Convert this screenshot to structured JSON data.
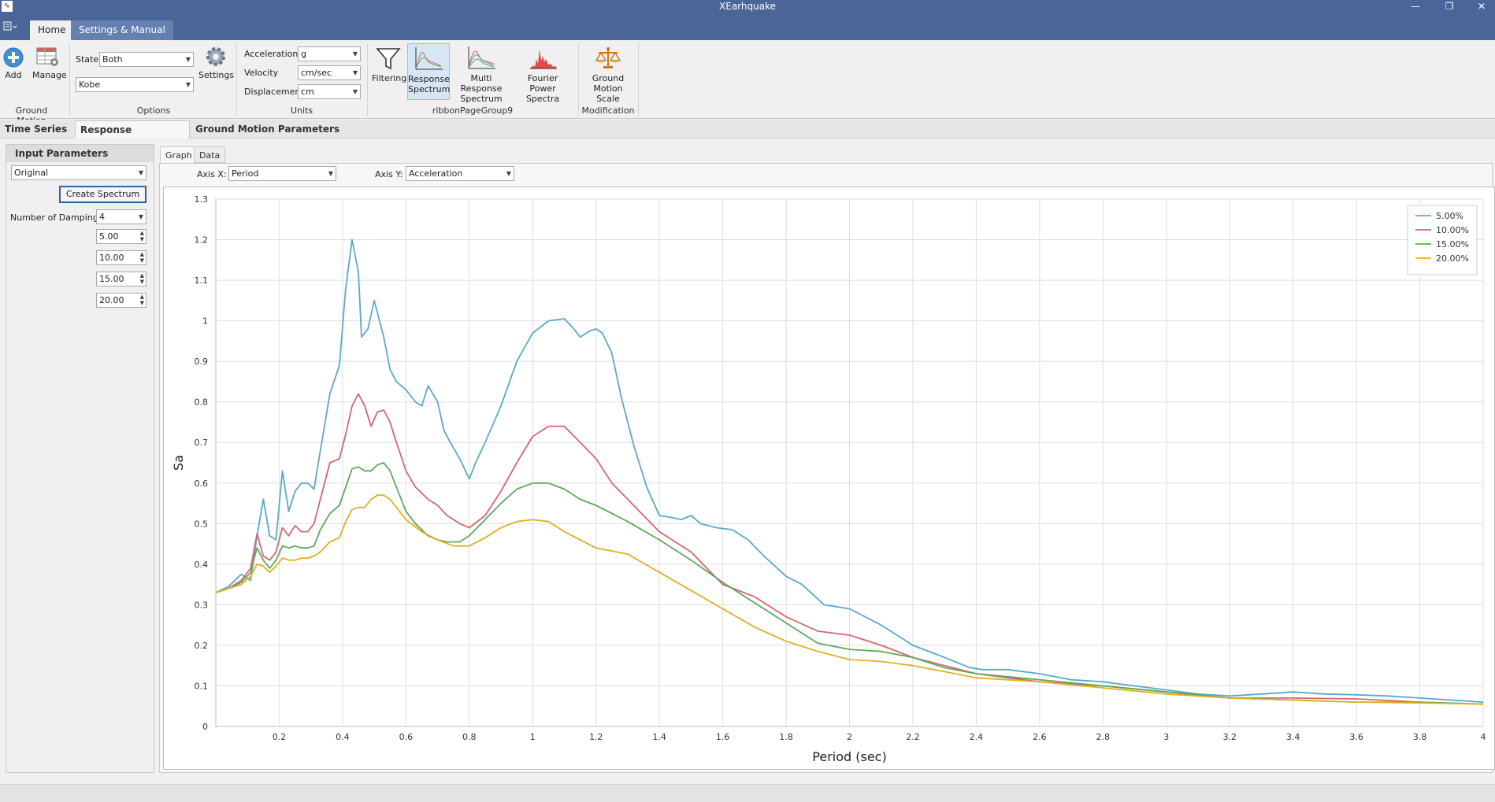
{
  "window": {
    "title": "XEarhquake",
    "app_icon": "seismograph-icon",
    "min_glyph": "—",
    "restore_glyph": "❐",
    "close_glyph": "✕"
  },
  "ribbon_tabs": [
    {
      "label": "Home",
      "active": true
    },
    {
      "label": "Settings & Manual",
      "active": false
    }
  ],
  "ribbon": {
    "ground_motion": {
      "add_label": "Add",
      "manage_label": "Manage",
      "group_label": "Ground Motion"
    },
    "options": {
      "state_label": "State",
      "state_value": "Both",
      "record_value": "Kobe",
      "settings_label": "Settings",
      "group_label": "Options"
    },
    "units": {
      "acceleration_label": "Acceleration",
      "acceleration_value": "g",
      "velocity_label": "Velocity",
      "velocity_value": "cm/sec",
      "displacement_label": "Displacement",
      "displacement_value": "cm",
      "group_label": "Units"
    },
    "page_group9": {
      "filtering_label": "Filtering",
      "response_spectrum_label": [
        "Response",
        "Spectrum"
      ],
      "multi_response_label": [
        "Multi Response",
        "Spectrum"
      ],
      "fourier_label": [
        "Fourier",
        "Power Spectra"
      ],
      "group_label": "ribbonPageGroup9"
    },
    "modification": {
      "ground_motion_scale_label": [
        "Ground",
        "Motion Scale"
      ],
      "group_label": "Modification"
    }
  },
  "doc_tabs": [
    {
      "label": "Time Series",
      "active": false
    },
    {
      "label": "Response Spectrum",
      "active": true,
      "close": "✕"
    },
    {
      "label": "Ground Motion Parameters",
      "active": false
    }
  ],
  "input_panel": {
    "title": "Input Parameters",
    "source_value": "Original",
    "create_button": "Create Spectrum",
    "dampings_label": "Number of Dampings:",
    "dampings_value": "4",
    "damping_values": [
      "5.00",
      "10.00",
      "15.00",
      "20.00"
    ]
  },
  "view_tabs": [
    {
      "label": "Graph",
      "active": true
    },
    {
      "label": "Data",
      "active": false
    }
  ],
  "axis_select": {
    "x_label": "Axis X:",
    "x_value": "Period",
    "y_label": "Axis Y:",
    "y_value": "Acceleration"
  },
  "chart_data": {
    "type": "line",
    "title": "",
    "xlabel": "Period (sec)",
    "ylabel": "Sa",
    "xlim": [
      0,
      4
    ],
    "ylim": [
      0,
      1.3
    ],
    "xticks": [
      "0.2",
      "0.4",
      "0.6",
      "0.8",
      "1",
      "1.2",
      "1.4",
      "1.6",
      "1.8",
      "2",
      "2.2",
      "2.4",
      "2.6",
      "2.8",
      "3",
      "3.2",
      "3.4",
      "3.6",
      "3.8",
      "4"
    ],
    "yticks": [
      "0",
      "0.1",
      "0.2",
      "0.3",
      "0.4",
      "0.5",
      "0.6",
      "0.7",
      "0.8",
      "0.9",
      "1",
      "1.1",
      "1.2",
      "1.3"
    ],
    "grid": true,
    "legend_position": "top-right",
    "series": [
      {
        "name": "5.00%",
        "color": "#5aa9c8",
        "x": [
          0,
          0.04,
          0.08,
          0.11,
          0.13,
          0.15,
          0.17,
          0.19,
          0.21,
          0.23,
          0.25,
          0.27,
          0.29,
          0.31,
          0.33,
          0.36,
          0.39,
          0.41,
          0.43,
          0.45,
          0.46,
          0.48,
          0.5,
          0.53,
          0.55,
          0.57,
          0.6,
          0.63,
          0.65,
          0.67,
          0.7,
          0.72,
          0.74,
          0.77,
          0.8,
          0.82,
          0.85,
          0.9,
          0.95,
          1.0,
          1.05,
          1.1,
          1.13,
          1.15,
          1.18,
          1.2,
          1.22,
          1.25,
          1.28,
          1.32,
          1.36,
          1.4,
          1.44,
          1.47,
          1.5,
          1.53,
          1.58,
          1.63,
          1.68,
          1.73,
          1.8,
          1.85,
          1.92,
          2.0,
          2.1,
          2.2,
          2.3,
          2.38,
          2.42,
          2.5,
          2.6,
          2.7,
          2.8,
          2.9,
          3.0,
          3.1,
          3.2,
          3.3,
          3.4,
          3.5,
          3.6,
          3.7,
          3.8,
          3.9,
          4.0
        ],
        "y": [
          0.33,
          0.345,
          0.375,
          0.36,
          0.47,
          0.56,
          0.47,
          0.46,
          0.63,
          0.53,
          0.58,
          0.6,
          0.6,
          0.585,
          0.68,
          0.82,
          0.89,
          1.08,
          1.2,
          1.12,
          0.96,
          0.98,
          1.05,
          0.96,
          0.88,
          0.85,
          0.83,
          0.8,
          0.79,
          0.84,
          0.8,
          0.73,
          0.7,
          0.66,
          0.61,
          0.65,
          0.7,
          0.79,
          0.9,
          0.97,
          1.0,
          1.005,
          0.98,
          0.96,
          0.975,
          0.98,
          0.97,
          0.92,
          0.81,
          0.69,
          0.59,
          0.52,
          0.515,
          0.51,
          0.52,
          0.5,
          0.49,
          0.485,
          0.46,
          0.42,
          0.37,
          0.35,
          0.3,
          0.29,
          0.25,
          0.2,
          0.17,
          0.145,
          0.14,
          0.14,
          0.13,
          0.115,
          0.11,
          0.1,
          0.09,
          0.08,
          0.075,
          0.08,
          0.085,
          0.08,
          0.078,
          0.075,
          0.07,
          0.065,
          0.06
        ]
      },
      {
        "name": "10.00%",
        "color": "#d56670",
        "x": [
          0,
          0.04,
          0.08,
          0.11,
          0.13,
          0.15,
          0.17,
          0.19,
          0.21,
          0.23,
          0.25,
          0.27,
          0.29,
          0.31,
          0.33,
          0.36,
          0.39,
          0.41,
          0.43,
          0.45,
          0.47,
          0.49,
          0.51,
          0.53,
          0.55,
          0.57,
          0.6,
          0.63,
          0.67,
          0.7,
          0.73,
          0.77,
          0.8,
          0.85,
          0.9,
          0.95,
          1.0,
          1.05,
          1.1,
          1.15,
          1.2,
          1.25,
          1.3,
          1.35,
          1.4,
          1.5,
          1.6,
          1.7,
          1.8,
          1.9,
          2.0,
          2.1,
          2.2,
          2.3,
          2.4,
          2.5,
          2.6,
          2.8,
          3.0,
          3.2,
          3.4,
          3.6,
          3.8,
          4.0
        ],
        "y": [
          0.33,
          0.34,
          0.36,
          0.39,
          0.475,
          0.42,
          0.41,
          0.43,
          0.49,
          0.47,
          0.495,
          0.48,
          0.48,
          0.5,
          0.56,
          0.65,
          0.66,
          0.72,
          0.79,
          0.82,
          0.79,
          0.74,
          0.775,
          0.78,
          0.75,
          0.7,
          0.63,
          0.59,
          0.56,
          0.545,
          0.52,
          0.5,
          0.49,
          0.52,
          0.58,
          0.65,
          0.715,
          0.74,
          0.74,
          0.7,
          0.66,
          0.6,
          0.56,
          0.52,
          0.48,
          0.43,
          0.35,
          0.32,
          0.27,
          0.235,
          0.225,
          0.2,
          0.17,
          0.15,
          0.13,
          0.12,
          0.11,
          0.1,
          0.085,
          0.07,
          0.07,
          0.068,
          0.06,
          0.055
        ]
      },
      {
        "name": "15.00%",
        "color": "#5fa85c",
        "x": [
          0,
          0.04,
          0.08,
          0.11,
          0.13,
          0.15,
          0.17,
          0.19,
          0.21,
          0.23,
          0.25,
          0.27,
          0.29,
          0.31,
          0.33,
          0.36,
          0.39,
          0.41,
          0.43,
          0.45,
          0.47,
          0.49,
          0.51,
          0.53,
          0.55,
          0.57,
          0.6,
          0.63,
          0.67,
          0.7,
          0.73,
          0.77,
          0.8,
          0.85,
          0.9,
          0.95,
          1.0,
          1.05,
          1.1,
          1.15,
          1.2,
          1.3,
          1.4,
          1.5,
          1.6,
          1.7,
          1.8,
          1.9,
          2.0,
          2.1,
          2.2,
          2.3,
          2.4,
          2.6,
          2.8,
          3.0,
          3.2,
          3.4,
          3.6,
          3.8,
          4.0
        ],
        "y": [
          0.33,
          0.34,
          0.355,
          0.38,
          0.44,
          0.41,
          0.39,
          0.41,
          0.445,
          0.44,
          0.445,
          0.44,
          0.44,
          0.445,
          0.485,
          0.525,
          0.545,
          0.59,
          0.635,
          0.64,
          0.63,
          0.63,
          0.645,
          0.65,
          0.63,
          0.59,
          0.53,
          0.5,
          0.47,
          0.46,
          0.455,
          0.455,
          0.47,
          0.51,
          0.55,
          0.585,
          0.6,
          0.6,
          0.585,
          0.56,
          0.545,
          0.505,
          0.46,
          0.41,
          0.355,
          0.305,
          0.255,
          0.205,
          0.19,
          0.185,
          0.17,
          0.145,
          0.13,
          0.115,
          0.1,
          0.085,
          0.07,
          0.065,
          0.06,
          0.06,
          0.055
        ]
      },
      {
        "name": "20.00%",
        "color": "#e0b020",
        "x": [
          0,
          0.04,
          0.08,
          0.11,
          0.13,
          0.15,
          0.17,
          0.19,
          0.21,
          0.23,
          0.25,
          0.27,
          0.29,
          0.31,
          0.33,
          0.36,
          0.39,
          0.41,
          0.43,
          0.45,
          0.47,
          0.49,
          0.51,
          0.53,
          0.55,
          0.57,
          0.6,
          0.65,
          0.7,
          0.75,
          0.8,
          0.85,
          0.9,
          0.95,
          1.0,
          1.05,
          1.1,
          1.15,
          1.2,
          1.3,
          1.4,
          1.5,
          1.6,
          1.7,
          1.8,
          1.9,
          2.0,
          2.1,
          2.2,
          2.3,
          2.4,
          2.6,
          2.8,
          3.0,
          3.2,
          3.4,
          3.6,
          3.8,
          4.0
        ],
        "y": [
          0.33,
          0.34,
          0.35,
          0.37,
          0.4,
          0.395,
          0.38,
          0.395,
          0.415,
          0.41,
          0.41,
          0.415,
          0.415,
          0.42,
          0.43,
          0.455,
          0.465,
          0.505,
          0.535,
          0.54,
          0.54,
          0.56,
          0.57,
          0.57,
          0.56,
          0.54,
          0.51,
          0.48,
          0.46,
          0.445,
          0.445,
          0.465,
          0.49,
          0.505,
          0.51,
          0.505,
          0.48,
          0.46,
          0.44,
          0.425,
          0.38,
          0.335,
          0.29,
          0.245,
          0.21,
          0.185,
          0.165,
          0.16,
          0.15,
          0.135,
          0.12,
          0.11,
          0.095,
          0.08,
          0.07,
          0.065,
          0.06,
          0.058,
          0.055
        ]
      }
    ]
  }
}
